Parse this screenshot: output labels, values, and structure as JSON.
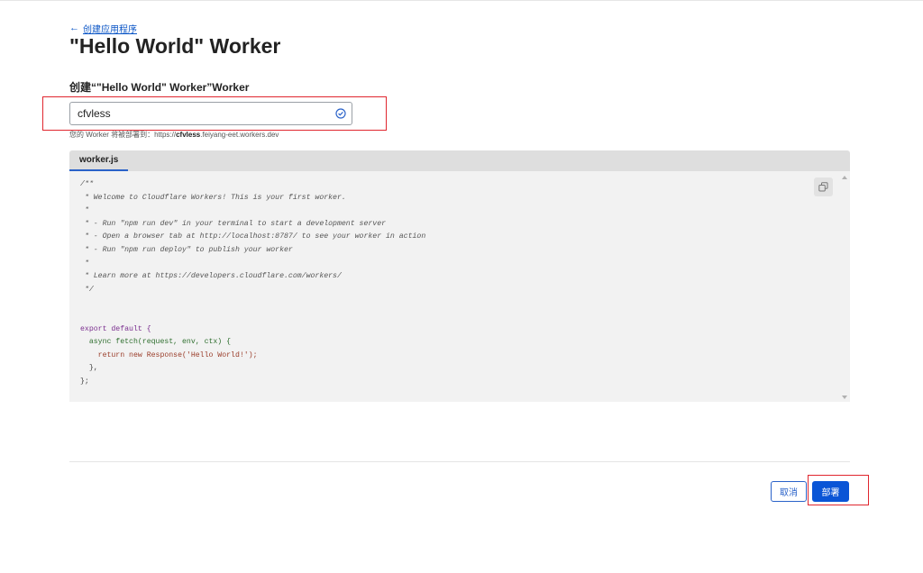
{
  "header": {
    "back_link": "创建应用程序",
    "title": "\"Hello World\" Worker"
  },
  "form": {
    "name_label": "创建“\"Hello World\" Worker”Worker",
    "name_value": "cfvless",
    "hint_prefix": "您的 Worker 将被部署到：https://",
    "hint_name": "cfvless",
    "hint_suffix": ".feiyang-eet.workers.dev"
  },
  "editor": {
    "tab": "worker.js",
    "code_lines": [
      "/**",
      " * Welcome to Cloudflare Workers! This is your first worker.",
      " *",
      " * - Run \"npm run dev\" in your terminal to start a development server",
      " * - Open a browser tab at http://localhost:8787/ to see your worker in action",
      " * - Run \"npm run deploy\" to publish your worker",
      " *",
      " * Learn more at https://developers.cloudflare.com/workers/",
      " */",
      "",
      "",
      "export default {",
      "  async fetch(request, env, ctx) {",
      "    return new Response('Hello World!');",
      "  },",
      "};"
    ]
  },
  "actions": {
    "cancel": "取消",
    "deploy": "部署"
  },
  "icons": {
    "back": "arrow-left-icon",
    "valid": "check-circle-icon",
    "copy": "copy-icon"
  },
  "colors": {
    "link": "#0a55c6",
    "primary": "#0a55d6",
    "highlight": "#e0262e"
  }
}
